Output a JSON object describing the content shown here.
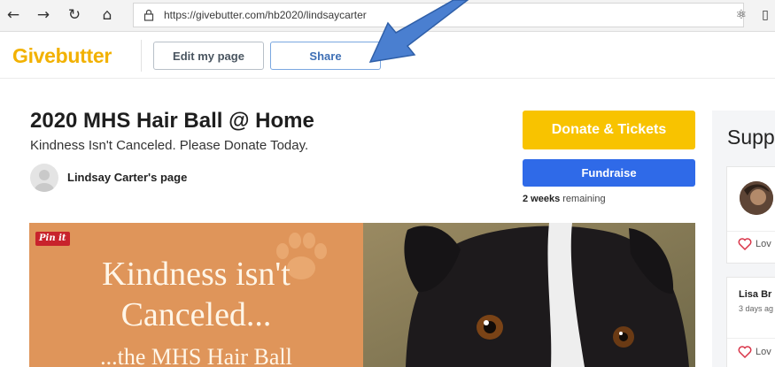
{
  "browser": {
    "url": "https://givebutter.com/hb2020/lindsaycarter",
    "icons": [
      "back-icon",
      "forward-icon",
      "refresh-icon",
      "home-icon",
      "lock-icon",
      "extension-icon",
      "reading-view-icon"
    ]
  },
  "header": {
    "logo": "Givebutter",
    "edit_label": "Edit my page",
    "share_label": "Share"
  },
  "campaign": {
    "title": "2020 MHS Hair Ball @ Home",
    "subtitle": "Kindness Isn't Canceled. Please Donate Today.",
    "owner": "Lindsay Carter's page",
    "donate_label": "Donate & Tickets",
    "fundraise_label": "Fundraise",
    "time_value": "2 weeks",
    "time_suffix": "remaining"
  },
  "hero": {
    "pin_label": "Pin it",
    "line1": "Kindness isn't",
    "line2": "Canceled...",
    "line3": "...the MHS Hair Ball"
  },
  "supporters": {
    "title": "Supp",
    "cards": [
      {
        "love_label": "Lov"
      },
      {
        "name": "Lisa Br",
        "time": "3 days ag",
        "love_label": "Lov"
      }
    ]
  },
  "colors": {
    "brand_yellow": "#f8c300",
    "fundraise_blue": "#2f6ae8",
    "hero_orange": "#df955a",
    "arrow_blue": "#4a7fd0"
  }
}
